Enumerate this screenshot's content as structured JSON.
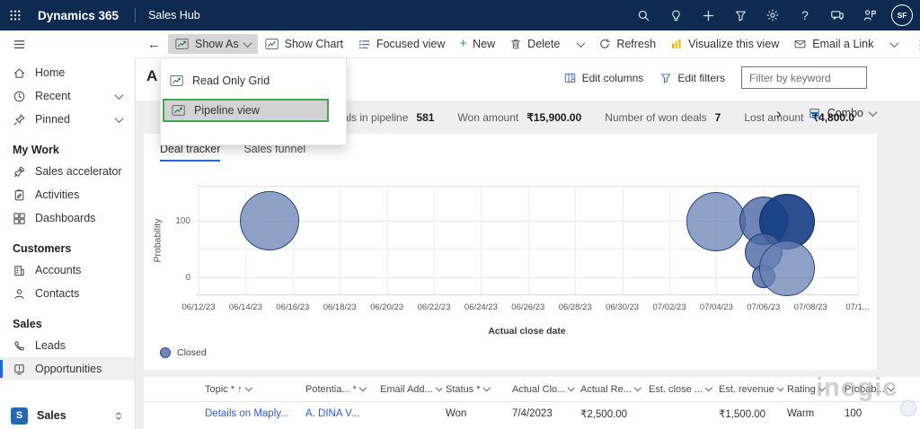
{
  "colors": {
    "topbar_bg": "#0e2a50",
    "accent": "#2266e3",
    "highlight_green": "#43a848",
    "bubble_light": "#6982b4",
    "bubble_dark": "#143c84",
    "visualize_yellow": "#f2c811",
    "link_blue": "#2b5fce"
  },
  "topbar": {
    "brand": "Dynamics 365",
    "area": "Sales Hub",
    "avatar_initials": "SF"
  },
  "command_bar": {
    "back": "←",
    "show_as": "Show As",
    "show_chart": "Show Chart",
    "focused_view": "Focused view",
    "new_label": "New",
    "delete_label": "Delete",
    "refresh": "Refresh",
    "visualize": "Visualize this view",
    "email_link": "Email a Link",
    "more": "⋮"
  },
  "view_dropdown": {
    "items": [
      {
        "label": "Read Only Grid",
        "highlighted": false
      },
      {
        "label": "Pipeline view",
        "highlighted": true
      }
    ]
  },
  "page_header": {
    "title_visible": "A",
    "edit_columns": "Edit columns",
    "edit_filters": "Edit filters",
    "filter_placeholder": "Filter by keyword"
  },
  "metrics_bar": {
    "metrics": [
      {
        "label": "eals in pipeline",
        "value": "581"
      },
      {
        "label": "Won amount",
        "value": "₹15,900.00"
      },
      {
        "label": "Number of won deals",
        "value": "7"
      },
      {
        "label": "Lost amount",
        "value": "₹4,800.0"
      }
    ],
    "more_chevron": "›",
    "chart_selector": "Combo"
  },
  "sidebar": {
    "top_items": [
      {
        "label": "Home",
        "icon": "home"
      },
      {
        "label": "Recent",
        "icon": "clock",
        "expandable": true
      },
      {
        "label": "Pinned",
        "icon": "pin",
        "expandable": true
      }
    ],
    "sections": [
      {
        "header": "My Work",
        "items": [
          {
            "label": "Sales accelerator",
            "icon": "rocket"
          },
          {
            "label": "Activities",
            "icon": "clipboard"
          },
          {
            "label": "Dashboards",
            "icon": "dashboard"
          }
        ]
      },
      {
        "header": "Customers",
        "items": [
          {
            "label": "Accounts",
            "icon": "building"
          },
          {
            "label": "Contacts",
            "icon": "person"
          }
        ]
      },
      {
        "header": "Sales",
        "items": [
          {
            "label": "Leads",
            "icon": "phone"
          },
          {
            "label": "Opportunities",
            "icon": "board",
            "selected": true
          }
        ]
      }
    ],
    "area_switcher": {
      "initial": "S",
      "label": "Sales"
    }
  },
  "chart_card": {
    "tabs": [
      {
        "label": "Deal tracker",
        "active": true
      },
      {
        "label": "Sales funnel",
        "active": false
      }
    ]
  },
  "chart_data": {
    "type": "bubble",
    "title": "Deal tracker",
    "xlabel": "Actual close date",
    "ylabel": "Probability",
    "x_categories": [
      "06/12/23",
      "06/14/23",
      "06/16/23",
      "06/18/23",
      "06/20/23",
      "06/22/23",
      "06/24/23",
      "06/26/23",
      "06/28/23",
      "06/30/23",
      "07/02/23",
      "07/04/23",
      "07/06/23",
      "07/08/23",
      "07/1..."
    ],
    "y_ticks": [
      0,
      100
    ],
    "legend": [
      {
        "name": "Closed",
        "color": "#6982b4"
      }
    ],
    "series": [
      {
        "name": "Closed",
        "points": [
          {
            "date": "06/15/23",
            "probability": 100,
            "size": 33,
            "shade": "light"
          },
          {
            "date": "07/04/23",
            "probability": 98,
            "size": 33,
            "shade": "light"
          },
          {
            "date": "07/06/23",
            "probability": 100,
            "size": 27,
            "shade": "medium"
          },
          {
            "date": "07/07/23",
            "probability": 99,
            "size": 31,
            "shade": "dark"
          },
          {
            "date": "07/06/23",
            "probability": 44,
            "size": 21,
            "shade": "medium"
          },
          {
            "date": "07/06/23",
            "probability": 2,
            "size": 13,
            "shade": "medium"
          },
          {
            "date": "07/07/23",
            "probability": 16,
            "size": 31,
            "shade": "light"
          }
        ]
      }
    ]
  },
  "grid": {
    "columns": [
      {
        "label": "Topic * ↑"
      },
      {
        "label": "Potentia... *"
      },
      {
        "label": "Email Add..."
      },
      {
        "label": "Status *"
      },
      {
        "label": "Actual Clo..."
      },
      {
        "label": "Actual Re..."
      },
      {
        "label": "Est. close ..."
      },
      {
        "label": "Est. revenue"
      },
      {
        "label": "Rating"
      },
      {
        "label": "Probab..."
      }
    ],
    "rows": [
      {
        "cells": [
          {
            "text": "Details on Maply...",
            "link": true
          },
          {
            "text": "A. DINA V...",
            "link": true
          },
          {
            "text": ""
          },
          {
            "text": "Won"
          },
          {
            "text": "7/4/2023"
          },
          {
            "text": "₹2,500.00"
          },
          {
            "text": ""
          },
          {
            "text": "₹1,500.00"
          },
          {
            "text": "Warm"
          },
          {
            "text": "100"
          }
        ]
      }
    ]
  },
  "watermark": "inogic"
}
